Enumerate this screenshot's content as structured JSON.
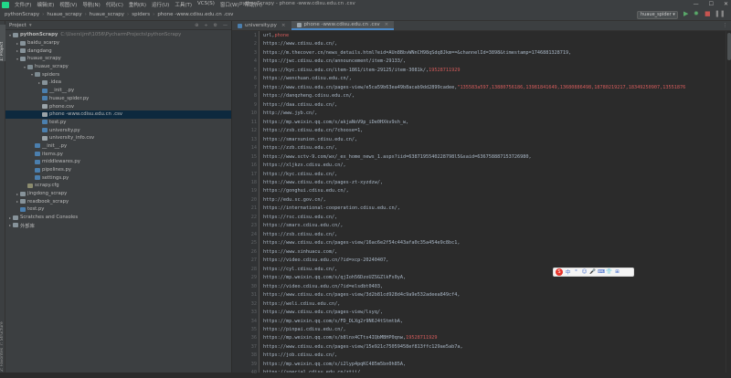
{
  "menubar": {
    "items": [
      "文件(F)",
      "编辑(E)",
      "视图(V)",
      "导航(N)",
      "代码(C)",
      "重构(R)",
      "运行(U)",
      "工具(T)",
      "VCS(S)",
      "窗口(W)",
      "帮助(H)"
    ],
    "window_title": "pythonScrapy - phone -www.cdisu.edu.cn .csv",
    "window_buttons": [
      "—",
      "☐",
      "✕"
    ]
  },
  "navbar": {
    "breadcrumbs": [
      "pythonScrapy",
      "huaue_scrapy",
      "huaue_scrapy",
      "spiders",
      "phone -www.cdisu.edu.cn .csv"
    ],
    "run_config": "huaue_spider",
    "run_icons": [
      "▶",
      "✹",
      "■",
      "❚❚"
    ]
  },
  "left_strip": {
    "top_label": "1: Project",
    "bottom_label_1": "7: Structure",
    "bottom_label_2": "2: Favorites"
  },
  "project": {
    "header": "Project",
    "header_icons": [
      "⊕",
      "÷",
      "⚙",
      "—"
    ],
    "tree": [
      {
        "label": "pythonScrapy",
        "path": "C:\\Users\\jmf\\1056\\PycharmProjects\\pythonScrapy",
        "level": 0,
        "open": true,
        "icon": "folder",
        "bold": true
      },
      {
        "label": "baidu_scarpy",
        "level": 1,
        "open": false,
        "icon": "folder"
      },
      {
        "label": "dangdang",
        "level": 1,
        "open": false,
        "icon": "folder"
      },
      {
        "label": "huaue_scrapy",
        "level": 1,
        "open": true,
        "icon": "folder"
      },
      {
        "label": "huaue_scrapy",
        "level": 2,
        "open": true,
        "icon": "pkg"
      },
      {
        "label": "spiders",
        "level": 3,
        "open": true,
        "icon": "pkg"
      },
      {
        "label": ".idea",
        "level": 4,
        "open": false,
        "icon": "folder"
      },
      {
        "label": "__init__.py",
        "level": 4,
        "icon": "py"
      },
      {
        "label": "huaue_spider.py",
        "level": 4,
        "icon": "py"
      },
      {
        "label": "phone.csv",
        "level": 4,
        "icon": "csv"
      },
      {
        "label": "phone -www.cdisu.edu.cn .csv",
        "level": 4,
        "icon": "csv",
        "selected": true
      },
      {
        "label": "test.py",
        "level": 4,
        "icon": "py"
      },
      {
        "label": "university.py",
        "level": 4,
        "icon": "py"
      },
      {
        "label": "university_info.csv",
        "level": 4,
        "icon": "csv"
      },
      {
        "label": "__init__.py",
        "level": 3,
        "icon": "py"
      },
      {
        "label": "items.py",
        "level": 3,
        "icon": "py"
      },
      {
        "label": "middlewares.py",
        "level": 3,
        "icon": "py"
      },
      {
        "label": "pipelines.py",
        "level": 3,
        "icon": "py"
      },
      {
        "label": "settings.py",
        "level": 3,
        "icon": "py"
      },
      {
        "label": "scrapy.cfg",
        "level": 2,
        "icon": "cfg"
      },
      {
        "label": "jingdong_scrapy",
        "level": 1,
        "open": false,
        "icon": "folder"
      },
      {
        "label": "readbook_scrapy",
        "level": 1,
        "open": false,
        "icon": "folder"
      },
      {
        "label": "test.py",
        "level": 1,
        "icon": "py"
      },
      {
        "label": "Scratches and Consoles",
        "level": 0,
        "open": false,
        "icon": "folder"
      },
      {
        "label": "外部库",
        "level": 0,
        "open": false,
        "icon": "folder"
      }
    ]
  },
  "tabs": [
    {
      "label": "university.py",
      "icon": "py",
      "active": false
    },
    {
      "label": "phone -www.cdisu.edu.cn .csv",
      "icon": "csv",
      "active": true
    }
  ],
  "tabs_more": "⋮",
  "ime": {
    "logo": "S",
    "glyphs": [
      "中",
      "°",
      "☺",
      "🎤",
      "⌨",
      "👕",
      "⊞"
    ]
  },
  "editor": {
    "lines": [
      [
        {
          "t": "url,",
          "c": "n"
        },
        {
          "t": "phone",
          "c": "r"
        }
      ],
      [
        {
          "t": "https://www.cdisu.edu.cn/,",
          "c": "n"
        }
      ],
      [
        {
          "t": "https://m.thecover.cn/news_details.html?eid=AUn8BbvWNnCH98qSdq8Jkm==&channelId=3898&timestamp=1746881328719,",
          "c": "n"
        }
      ],
      [
        {
          "t": "https://jwc.cdisu.edu.cn/announcement/item-29133/,",
          "c": "n"
        }
      ],
      [
        {
          "t": "https://kyc.cdisu.edu.cn/item-1861/item-29125/item-3081k/,",
          "c": "n"
        },
        {
          "t": "19528711929",
          "c": "r"
        }
      ],
      [
        {
          "t": "https://wenchuan.cdisu.edu.cn/,",
          "c": "n"
        }
      ],
      [
        {
          "t": "https://www.cdisu.edu.cn/pages-view/e5ca59b63ea49b8acab9dd2899cadee,",
          "c": "n"
        },
        {
          "t": "\"135583a597,13880756186,13981841649,13680886498,18780219217,18349250907,13551876",
          "c": "r"
        }
      ],
      [
        {
          "t": "https://danqzheng.cdisu.edu.cn/,",
          "c": "n"
        }
      ],
      [
        {
          "t": "https://daa.cdisu.edu.cn/,",
          "c": "n"
        }
      ],
      [
        {
          "t": "http://www.jyb.cn/,",
          "c": "n"
        }
      ],
      [
        {
          "t": "https://mp.weixin.qq.com/s/akjaNoV9p_iDe0HXkv9sh_w,",
          "c": "n"
        }
      ],
      [
        {
          "t": "https://zsb.cdisu.edu.cn/?choose=1,",
          "c": "n"
        }
      ],
      [
        {
          "t": "https://smarxunion.cdisu.edu.cn/,",
          "c": "n"
        }
      ],
      [
        {
          "t": "https://zzb.cdisu.edu.cn/,",
          "c": "n"
        }
      ],
      [
        {
          "t": "https://www.sctv-9.com/wx/_ex_home_news_1.aspx?iid=6387195540228798l5&said=636758887153726980,",
          "c": "n"
        }
      ],
      [
        {
          "t": "https://xljkzx.cdisu.edu.cn/,",
          "c": "n"
        }
      ],
      [
        {
          "t": "https://kyc.cdisu.edu.cn/,",
          "c": "n"
        }
      ],
      [
        {
          "t": "https://www.cdisu.edu.cn/pages-zt-xyzdzw/,",
          "c": "n"
        }
      ],
      [
        {
          "t": "https://gonghui.cdisu.edu.cn/,",
          "c": "n"
        }
      ],
      [
        {
          "t": "http://edu.sc.gov.cn/,",
          "c": "n"
        }
      ],
      [
        {
          "t": "https://international-cooperation.cdisu.edu.cn/,",
          "c": "n"
        }
      ],
      [
        {
          "t": "https://rsc.cdisu.edu.cn/,",
          "c": "n"
        }
      ],
      [
        {
          "t": "https://smarx.cdisu.edu.cn/,",
          "c": "n"
        }
      ],
      [
        {
          "t": "https://zsb.cdisu.edu.cn/,",
          "c": "n"
        }
      ],
      [
        {
          "t": "https://www.cdisu.edu.cn/pages-view/16ac6e2f54c443afa0c35a454e9c8bc1,",
          "c": "n"
        }
      ],
      [
        {
          "t": "https://www.xinhuacu.com/,",
          "c": "n"
        }
      ],
      [
        {
          "t": "https://video.cdisu.edu.cn/?id=xcp-20240407,",
          "c": "n"
        }
      ],
      [
        {
          "t": "https://cyl.cdisu.edu.cn/,",
          "c": "n"
        }
      ],
      [
        {
          "t": "https://mp.weixin.qq.com/s/qjIoh56DzoUZSGZlkFs0yA,",
          "c": "n"
        }
      ],
      [
        {
          "t": "https://video.cdisu.edu.cn/?id=elsdbt0403,",
          "c": "n"
        }
      ],
      [
        {
          "t": "https://www.cdisu.edu.cn/pages-view/3d2b81cd928d4c9a9e532adeea849cf4,",
          "c": "n"
        }
      ],
      [
        {
          "t": "https://weli.cdisu.edu.cn/,",
          "c": "n"
        }
      ],
      [
        {
          "t": "https://www.cdisu.edu.cn/pages-view/lsyq/,",
          "c": "n"
        }
      ],
      [
        {
          "t": "https://mp.weixin.qq.com/s/FD_DLXg2r9N6J4tStmtbA,",
          "c": "n"
        }
      ],
      [
        {
          "t": "https://pinpai.cdisu.edu.cn/,",
          "c": "n"
        }
      ],
      [
        {
          "t": "https://mp.weixin.qq.com/s/b8lnx4CTts4IQbMBHP0qnw,",
          "c": "n"
        },
        {
          "t": "19528711929",
          "c": "r"
        }
      ],
      [
        {
          "t": "https://www.cdisu.edu.cn/pages-view/15e921c75059458ef813ffc129ae5ab7a,",
          "c": "n"
        }
      ],
      [
        {
          "t": "https://job.cdisu.edu.cn/,",
          "c": "n"
        }
      ],
      [
        {
          "t": "https://mp.weixin.qq.com/s/i2lyp4pqKC485m5bn0h85A,",
          "c": "n"
        }
      ],
      [
        {
          "t": "https://special.cdisu.edu.cn/ztjj/,",
          "c": "n"
        }
      ]
    ]
  }
}
